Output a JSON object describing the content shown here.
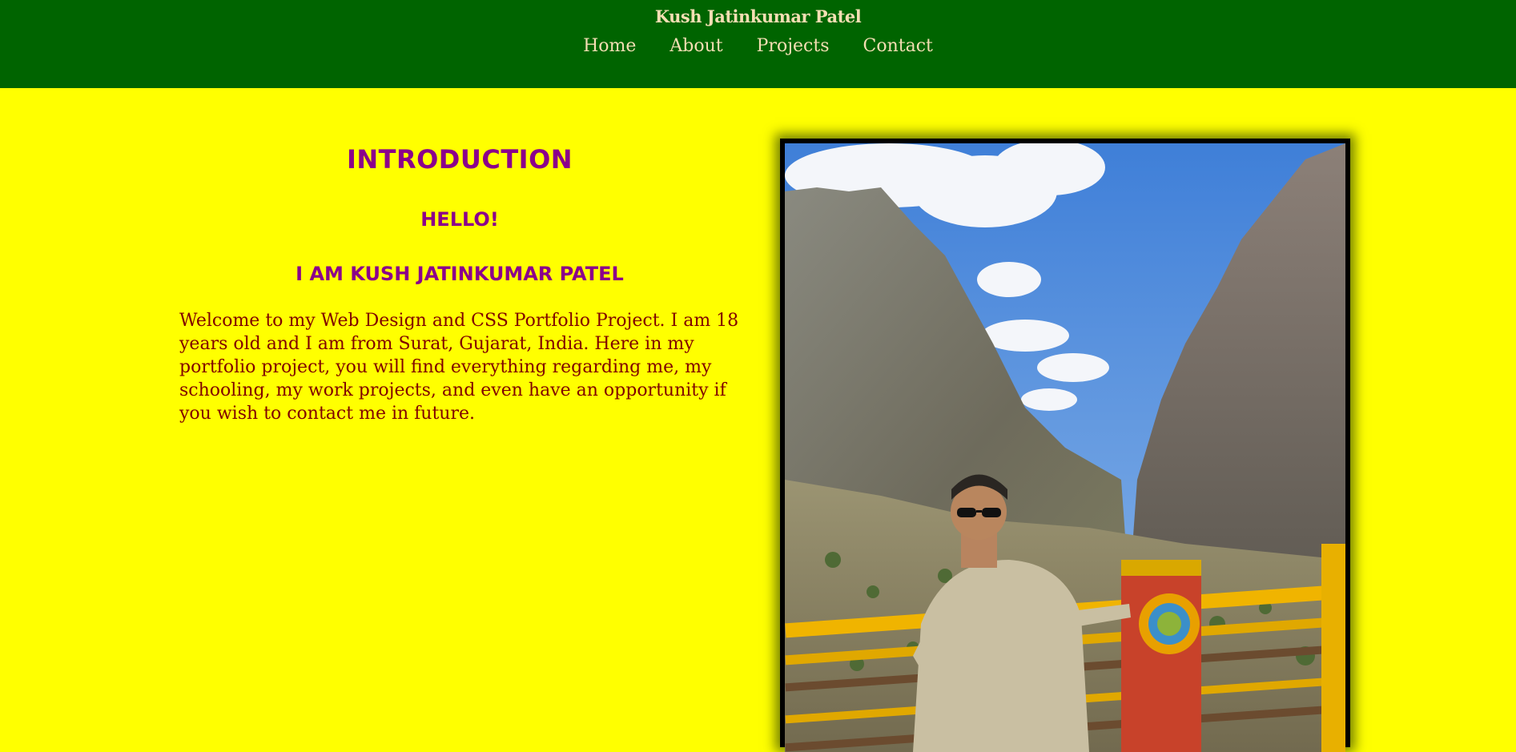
{
  "header": {
    "site_title": "Kush Jatinkumar Patel",
    "background_color": "#006400",
    "text_color": "#f5deb3"
  },
  "nav": {
    "items": [
      {
        "label": "Home"
      },
      {
        "label": "About"
      },
      {
        "label": "Projects"
      },
      {
        "label": "Contact"
      }
    ]
  },
  "intro": {
    "heading": "INTRODUCTION",
    "greeting": "HELLO!",
    "name_line": "I AM KUSH JATINKUMAR PATEL",
    "body": "Welcome to my Web Design and CSS Portfolio Project. I am 18 years old and I am from Surat, Gujarat, India. Here in my portfolio project, you will find everything regarding me, my schooling, my work projects, and even have an opportunity if you wish to contact me in future.",
    "heading_color": "#8b008b",
    "body_color": "#800000"
  },
  "page": {
    "background_color": "#ffff00"
  },
  "photo": {
    "subject": "profile-photo"
  }
}
